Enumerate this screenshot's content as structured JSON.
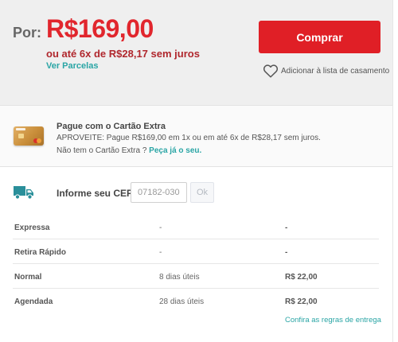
{
  "price": {
    "prefix": "Por:",
    "value": "R$169,00",
    "installments": "ou até 6x de R$28,17 sem juros",
    "see_installments": "Ver Parcelas"
  },
  "actions": {
    "buy_label": "Comprar",
    "wishlist_label": "Adicionar à lista de casamento"
  },
  "card_offer": {
    "title": "Pague com o Cartão Extra",
    "line1": "APROVEITE: Pague R$169,00 em 1x ou em até 6x de R$28,17 sem juros.",
    "line2_prefix": "Não tem o Cartão Extra ?",
    "line2_link": "Peça já o seu."
  },
  "shipping": {
    "cep_label": "Informe seu CEP:",
    "cep_placeholder": "07182-030",
    "ok_label": "Ok",
    "rows": [
      {
        "name": "Expressa",
        "time": "-",
        "price": "-"
      },
      {
        "name": "Retira Rápido",
        "time": "-",
        "price": "-"
      },
      {
        "name": "Normal",
        "time": "8 dias úteis",
        "price": "R$ 22,00"
      },
      {
        "name": "Agendada",
        "time": "28 dias úteis",
        "price": "R$ 22,00"
      }
    ],
    "rules_link": "Confira as regras de entrega"
  },
  "colors": {
    "price_red": "#e1262d",
    "installments_red": "#b0272d",
    "buy_button": "#e01f26",
    "link_teal": "#2aa5a5",
    "price_bg": "#efefef",
    "truck_teal": "#2a8f9a"
  },
  "icons": {
    "wishlist": "heart-outline-icon",
    "card": "credit-card-icon",
    "shipping": "truck-icon"
  }
}
